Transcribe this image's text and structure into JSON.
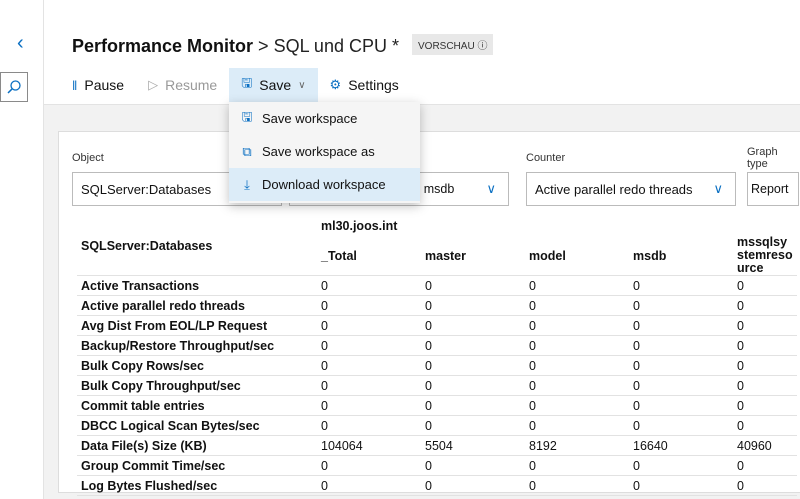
{
  "header": {
    "title": "Performance Monitor",
    "separator": ">",
    "subtitle": "SQL und CPU *",
    "badge": "VORSCHAU ⓘ"
  },
  "toolbar": {
    "pause": "Pause",
    "resume": "Resume",
    "save": "Save",
    "settings": "Settings"
  },
  "save_menu": [
    "Save workspace",
    "Save workspace as",
    "Download workspace"
  ],
  "filters": {
    "object_label": "Object",
    "object_value": "SQLServer:Databases",
    "instances_value": "_Total, master, model, msdb",
    "counter_label": "Counter",
    "counter_value": "Active parallel redo threads",
    "graph_label": "Graph type",
    "graph_value": "Report"
  },
  "table": {
    "corner": "SQLServer:Databases",
    "host": "ml30.joos.int",
    "columns": [
      "_Total",
      "master",
      "model",
      "msdb",
      "mssqlsystemresource"
    ],
    "rows": [
      {
        "label": "Active Transactions",
        "values": [
          "0",
          "0",
          "0",
          "0",
          "0"
        ]
      },
      {
        "label": "Active parallel redo threads",
        "values": [
          "0",
          "0",
          "0",
          "0",
          "0"
        ]
      },
      {
        "label": "Avg Dist From EOL/LP Request",
        "values": [
          "0",
          "0",
          "0",
          "0",
          "0"
        ]
      },
      {
        "label": "Backup/Restore Throughput/sec",
        "values": [
          "0",
          "0",
          "0",
          "0",
          "0"
        ]
      },
      {
        "label": "Bulk Copy Rows/sec",
        "values": [
          "0",
          "0",
          "0",
          "0",
          "0"
        ]
      },
      {
        "label": "Bulk Copy Throughput/sec",
        "values": [
          "0",
          "0",
          "0",
          "0",
          "0"
        ]
      },
      {
        "label": "Commit table entries",
        "values": [
          "0",
          "0",
          "0",
          "0",
          "0"
        ]
      },
      {
        "label": "DBCC Logical Scan Bytes/sec",
        "values": [
          "0",
          "0",
          "0",
          "0",
          "0"
        ]
      },
      {
        "label": "Data File(s) Size (KB)",
        "values": [
          "104064",
          "5504",
          "8192",
          "16640",
          "40960"
        ]
      },
      {
        "label": "Group Commit Time/sec",
        "values": [
          "0",
          "0",
          "0",
          "0",
          "0"
        ]
      },
      {
        "label": "Log Bytes Flushed/sec",
        "values": [
          "0",
          "0",
          "0",
          "0",
          "0"
        ]
      }
    ]
  }
}
